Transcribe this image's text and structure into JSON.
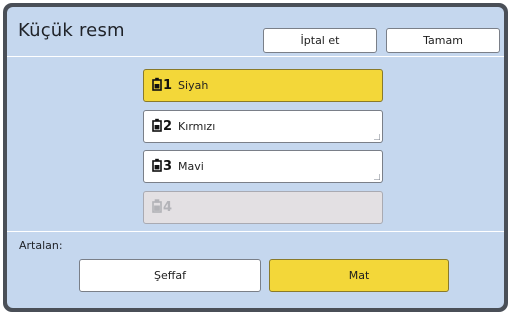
{
  "dialog": {
    "title": "Küçük resm",
    "cancel_label": "İptal et",
    "ok_label": "Tamam"
  },
  "drums": [
    {
      "number": "1",
      "name": "Siyah",
      "state": "selected"
    },
    {
      "number": "2",
      "name": "Kırmızı",
      "state": "normal"
    },
    {
      "number": "3",
      "name": "Mavi",
      "state": "normal"
    },
    {
      "number": "4",
      "name": "",
      "state": "disabled"
    }
  ],
  "background": {
    "label": "Artalan:",
    "options": [
      {
        "label": "Şeffaf",
        "selected": false
      },
      {
        "label": "Mat",
        "selected": true
      }
    ]
  },
  "colors": {
    "accent": "#f3d739",
    "panel": "#c5d7ee",
    "frame": "#4a4f57"
  },
  "icons": {
    "drum": "ink-cylinder-icon"
  }
}
